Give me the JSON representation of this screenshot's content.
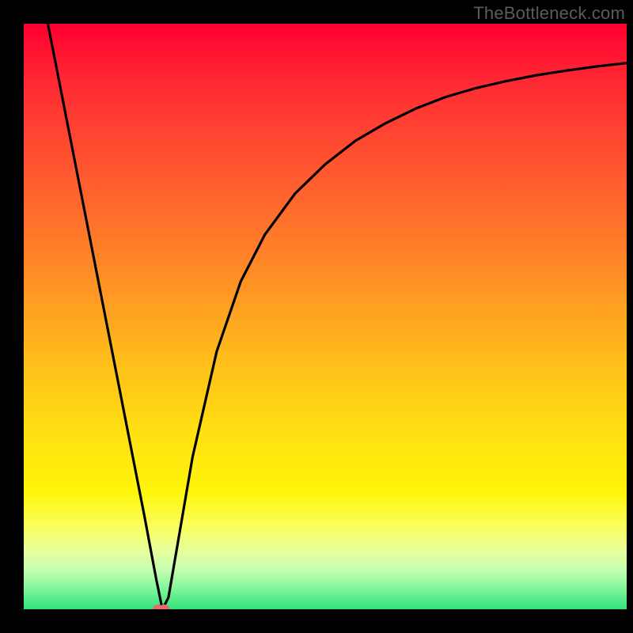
{
  "attribution": "TheBottleneck.com",
  "colors": {
    "gradient_top": "#ff0030",
    "gradient_mid_orange": "#ff8a26",
    "gradient_mid_yellow": "#ffe012",
    "gradient_bottom": "#2fe37a",
    "curve": "#000000",
    "dot": "#e86a6a",
    "frame_bg": "#000000"
  },
  "chart_data": {
    "type": "line",
    "title": "",
    "xlabel": "",
    "ylabel": "",
    "xlim": [
      0,
      100
    ],
    "ylim": [
      0,
      100
    ],
    "series": [
      {
        "name": "bottleneck-curve",
        "x": [
          4,
          8,
          12,
          16,
          20,
          22,
          23,
          24,
          26,
          28,
          32,
          36,
          40,
          45,
          50,
          55,
          60,
          65,
          70,
          75,
          80,
          85,
          90,
          95,
          100
        ],
        "values": [
          100,
          79,
          58,
          37,
          16,
          5,
          0,
          2,
          14,
          26,
          44,
          56,
          64,
          71,
          76,
          80,
          83,
          85.5,
          87.5,
          89,
          90.2,
          91.2,
          92,
          92.7,
          93.3
        ]
      }
    ],
    "markers": [
      {
        "name": "minimum-dot-left",
        "x": 22.3,
        "y": 0,
        "color": "#e86a6a"
      },
      {
        "name": "minimum-dot-right",
        "x": 23.3,
        "y": 0,
        "color": "#e86a6a"
      }
    ],
    "annotations": [
      {
        "text": "TheBottleneck.com",
        "position": "top-right"
      }
    ]
  }
}
